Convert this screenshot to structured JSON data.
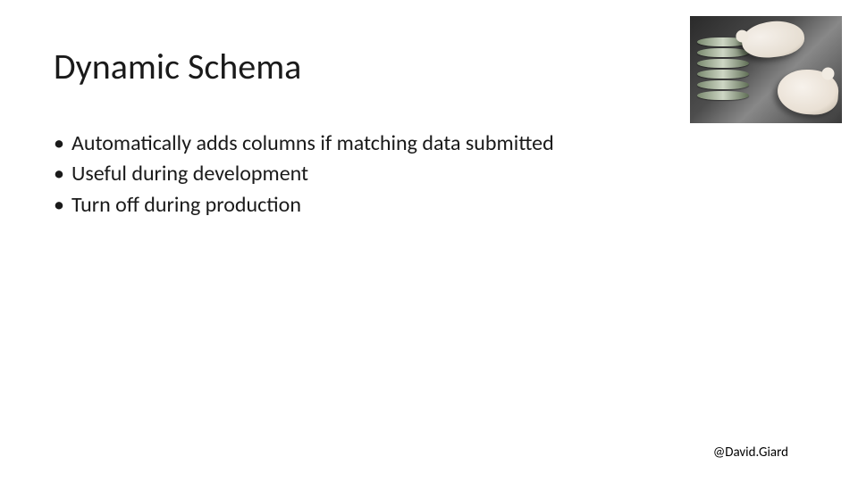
{
  "title": "Dynamic Schema",
  "bullets": [
    "Automatically adds columns if matching data submitted",
    "Useful during development",
    "Turn off during production"
  ],
  "footer": "@David.Giard",
  "image_alt": "white-mice-on-stack"
}
